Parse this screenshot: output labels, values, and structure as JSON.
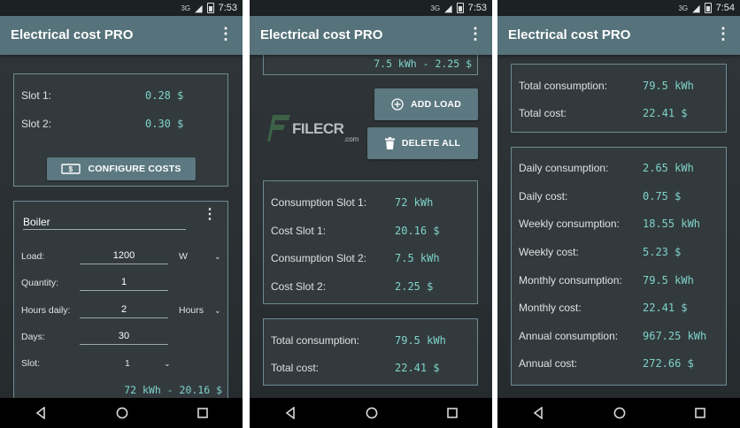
{
  "app_title": "Electrical cost PRO",
  "status": {
    "s1": {
      "network": "3G",
      "time": "7:53"
    },
    "s2": {
      "network": "3G",
      "time": "7:53"
    },
    "s3": {
      "network": "3G",
      "time": "7:54"
    }
  },
  "screen1": {
    "slots": [
      {
        "label": "Slot 1:",
        "value": "0.28 $"
      },
      {
        "label": "Slot 2:",
        "value": "0.30 $"
      }
    ],
    "configure_button": "CONFIGURE COSTS",
    "load": {
      "name": "Boiler",
      "fields": [
        {
          "label": "Load:",
          "value": "1200",
          "unit": "W"
        },
        {
          "label": "Quantity:",
          "value": "1"
        },
        {
          "label": "Hours daily:",
          "value": "2",
          "unit": "Hours"
        },
        {
          "label": "Days:",
          "value": "30"
        },
        {
          "label": "Slot:",
          "value": "1"
        }
      ],
      "summary": "72 kWh - 20.16 $"
    }
  },
  "screen2": {
    "top_summary": "7.5 kWh - 2.25 $",
    "add_button": "ADD LOAD",
    "delete_button": "DELETE ALL",
    "watermark": "FILECR",
    "watermark_sub": ".com",
    "slot_details": [
      {
        "label": "Consumption Slot 1:",
        "value": "72 kWh"
      },
      {
        "label": "Cost Slot 1:",
        "value": "20.16 $"
      },
      {
        "label": "Consumption Slot 2:",
        "value": "7.5 kWh"
      },
      {
        "label": "Cost Slot 2:",
        "value": "2.25 $"
      }
    ],
    "totals": [
      {
        "label": "Total consumption:",
        "value": "79.5 kWh"
      },
      {
        "label": "Total cost:",
        "value": "22.41 $"
      }
    ]
  },
  "screen3": {
    "totals": [
      {
        "label": "Total consumption:",
        "value": "79.5 kWh"
      },
      {
        "label": "Total cost:",
        "value": "22.41 $"
      }
    ],
    "periods": [
      {
        "label": "Daily consumption:",
        "value": "2.65 kWh"
      },
      {
        "label": "Daily cost:",
        "value": "0.75 $"
      },
      {
        "label": "Weekly consumption:",
        "value": "18.55 kWh"
      },
      {
        "label": "Weekly cost:",
        "value": "5.23 $"
      },
      {
        "label": "Monthly consumption:",
        "value": "79.5 kWh"
      },
      {
        "label": "Monthly cost:",
        "value": "22.41 $"
      },
      {
        "label": "Annual consumption:",
        "value": "967.25 kWh"
      },
      {
        "label": "Annual cost:",
        "value": "272.66 $"
      }
    ]
  },
  "icons": [
    "more-vert-icon",
    "dollar-bill-icon",
    "add-circle-icon",
    "trash-icon",
    "chevron-down-icon",
    "back-icon",
    "home-icon",
    "recents-icon",
    "signal-icon",
    "battery-icon"
  ]
}
